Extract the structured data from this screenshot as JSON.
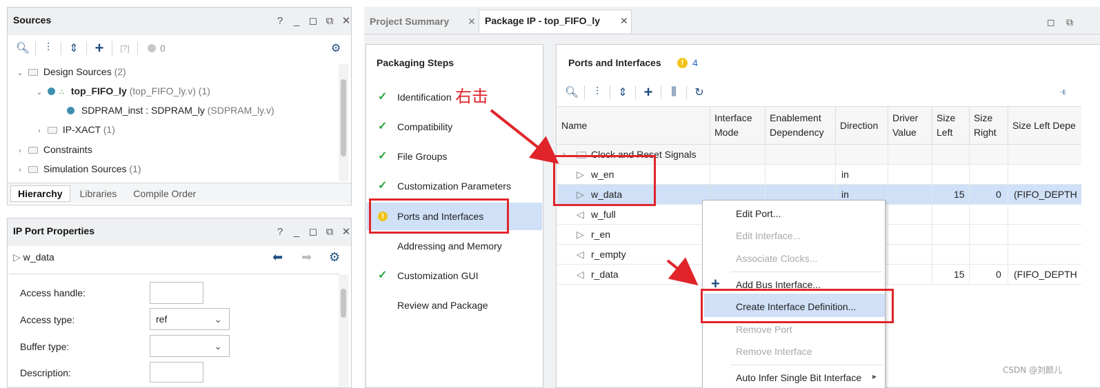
{
  "sources_panel": {
    "title": "Sources",
    "ctrl_help": "?",
    "ctrl_min": "_",
    "ctrl_restore": "◻",
    "ctrl_float": "⧉",
    "ctrl_close": "✕",
    "status_count": "0",
    "tree": {
      "design_sources": "Design Sources",
      "design_sources_count": "(2)",
      "top_name": "top_FIFO_ly",
      "top_file": "(top_FIFO_ly.v)",
      "top_count": "(1)",
      "sdram_name": "SDPRAM_inst : SDPRAM_ly",
      "sdram_file": "(SDPRAM_ly.v)",
      "ipxact": "IP-XACT",
      "ipxact_count": "(1)",
      "constraints": "Constraints",
      "sim_sources": "Simulation Sources",
      "sim_count": "(1)"
    },
    "tabs": [
      "Hierarchy",
      "Libraries",
      "Compile Order"
    ]
  },
  "ip_props_panel": {
    "title": "IP Port Properties",
    "selected": "w_data",
    "fields": {
      "access_handle_label": "Access handle:",
      "access_type_label": "Access type:",
      "access_type_value": "ref",
      "buffer_type_label": "Buffer type:",
      "description_label": "Description:"
    }
  },
  "main_tabs": {
    "project_summary": "Project Summary",
    "package_ip": "Package IP - top_FIFO_ly"
  },
  "packaging_steps": {
    "title": "Packaging Steps",
    "steps": [
      {
        "label": "Identification",
        "status": "done"
      },
      {
        "label": "Compatibility",
        "status": "done"
      },
      {
        "label": "File Groups",
        "status": "done"
      },
      {
        "label": "Customization Parameters",
        "status": "done"
      },
      {
        "label": "Ports and Interfaces",
        "status": "warning"
      },
      {
        "label": "Addressing and Memory",
        "status": "none"
      },
      {
        "label": "Customization GUI",
        "status": "done"
      },
      {
        "label": "Review and Package",
        "status": "none"
      }
    ]
  },
  "ports_panel": {
    "title": "Ports and Interfaces",
    "warning_count": "4",
    "columns": {
      "name": "Name",
      "interface_mode": "Interface\nMode",
      "enablement": "Enablement\nDependency",
      "direction": "Direction",
      "driver_value": "Driver\nValue",
      "size_left": "Size\nLeft",
      "size_right": "Size\nRight",
      "size_left_dep": "Size Left Depe"
    },
    "rows": [
      {
        "name": "Clock and Reset Signals",
        "direction": "",
        "size_left": "",
        "size_right": "",
        "size_left_dep": ""
      },
      {
        "name": "w_en",
        "direction": "in",
        "size_left": "",
        "size_right": "",
        "size_left_dep": ""
      },
      {
        "name": "w_data",
        "direction": "in",
        "size_left": "15",
        "size_right": "0",
        "size_left_dep": "(FIFO_DEPTH"
      },
      {
        "name": "w_full",
        "direction": "",
        "size_left": "",
        "size_right": "",
        "size_left_dep": ""
      },
      {
        "name": "r_en",
        "direction": "",
        "size_left": "",
        "size_right": "",
        "size_left_dep": ""
      },
      {
        "name": "r_empty",
        "direction": "",
        "size_left": "",
        "size_right": "",
        "size_left_dep": ""
      },
      {
        "name": "r_data",
        "direction": "",
        "size_left": "15",
        "size_right": "0",
        "size_left_dep": "(FIFO_DEPTH"
      }
    ]
  },
  "context_menu": {
    "items": [
      {
        "label": "Edit Port...",
        "enabled": true
      },
      {
        "label": "Edit Interface...",
        "enabled": false
      },
      {
        "label": "Associate Clocks...",
        "enabled": false
      },
      {
        "label": "Add Bus Interface...",
        "enabled": true
      },
      {
        "label": "Create Interface Definition...",
        "enabled": true
      },
      {
        "label": "Remove Port",
        "enabled": false
      },
      {
        "label": "Remove Interface",
        "enabled": false
      },
      {
        "label": "Auto Infer Single Bit Interface",
        "enabled": true
      }
    ]
  },
  "annotation": {
    "right_click": "右击",
    "watermark": "CSDN @刘颜儿"
  },
  "colors": {
    "accent": "#1f4f82",
    "selection": "#cfe0f7",
    "annotation_red": "#e0242a",
    "check_green": "#2aa33a",
    "warning_yellow": "#f2c318"
  }
}
